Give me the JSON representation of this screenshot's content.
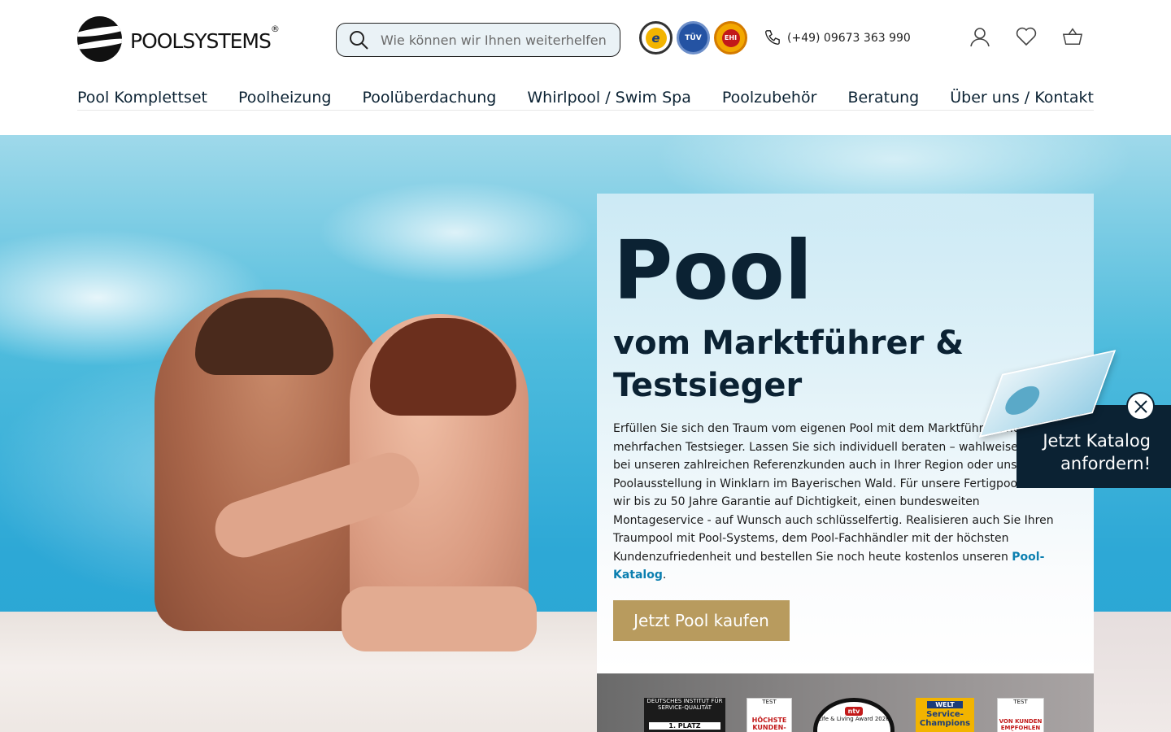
{
  "header": {
    "logo_text": "POOLSYSTEMS",
    "logo_reg": "®",
    "search_placeholder": "Wie können wir Ihnen weiterhelfen",
    "phone": "(+49) 09673 363 990",
    "seals": {
      "trusted": "e",
      "tuv": "TÜV",
      "ehi": "EHI"
    }
  },
  "nav": [
    "Pool Komplettset",
    "Poolheizung",
    "Poolüberdachung",
    "Whirlpool / Swim Spa",
    "Poolzubehör",
    "Beratung",
    "Über uns / Kontakt"
  ],
  "hero": {
    "title": "Pool",
    "subtitle": "vom Marktführer & Testsieger",
    "text": "Erfüllen Sie sich den Traum vom eigenen Pool mit dem Marktführer und mehrfachen Testsieger. Lassen Sie sich individuell beraten – wahlweise vor Ort, bei unseren zahlreichen Referenzkunden auch in Ihrer Region oder unserer Poolausstellung in Winklarn im Bayerischen Wald. Für unsere Fertigpools bieten wir bis zu 50 Jahre Garantie auf Dichtigkeit, einen bundesweiten Montageservice - auf Wunsch auch schlüsselfertig. Realisieren auch Sie Ihren Traumpool mit Pool-Systems, dem Pool-Fachhändler mit der höchsten Kundenzufriedenheit und bestellen Sie noch heute kostenlos unseren ",
    "link": "Pool-Katalog",
    "text_end": ".",
    "cta": "Jetzt Pool kaufen"
  },
  "awards": {
    "a1_head": "DEUTSCHES INSTITUT FÜR SERVICE-QUALITÄT",
    "a1_place": "1. PLATZ",
    "a2_head": "TEST",
    "a2_label": "HÖCHSTE KUNDEN-",
    "a3_brand": "ntv",
    "a3_text": "Life & Living Award 2026",
    "a4_brand": "WELT",
    "a4_text": "Service-Champions",
    "a5_head": "TEST",
    "a5_label": "VON KUNDEN EMPFOHLEN HÖCHSTE"
  },
  "popup": {
    "line1": "Jetzt Katalog",
    "line2": "anfordern!"
  },
  "colors": {
    "navy": "#0b2233",
    "gold": "#b89b5e",
    "link": "#0b7fb0"
  }
}
